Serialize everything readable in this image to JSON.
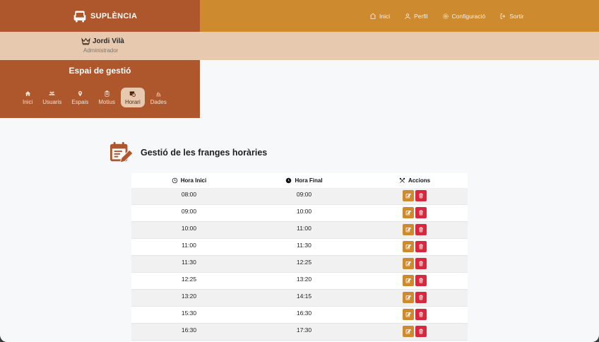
{
  "brand": {
    "name": "SUPLÈNCIA"
  },
  "nav": [
    {
      "label": "Inici",
      "icon": "home-icon"
    },
    {
      "label": "Perfil",
      "icon": "user-icon"
    },
    {
      "label": "Configuració",
      "icon": "gear-icon"
    },
    {
      "label": "Sortir",
      "icon": "logout-icon"
    }
  ],
  "user": {
    "name": "Jordi Vilà",
    "role": "Administrador"
  },
  "panel": {
    "title": "Espai de gestió",
    "tabs": [
      {
        "label": "Inici",
        "icon": "home-icon"
      },
      {
        "label": "Usuaris",
        "icon": "users-icon"
      },
      {
        "label": "Espais",
        "icon": "map-pin-icon"
      },
      {
        "label": "Motius",
        "icon": "clipboard-icon"
      },
      {
        "label": "Horari",
        "icon": "calendar-clock-icon",
        "active": true
      },
      {
        "label": "Dades",
        "icon": "chart-icon"
      }
    ]
  },
  "section": {
    "title": "Gestió de les franges horàries"
  },
  "table": {
    "headers": {
      "start": "Hora Inici",
      "end": "Hora Final",
      "actions": "Accions"
    },
    "rows": [
      {
        "start": "08:00",
        "end": "09:00"
      },
      {
        "start": "09:00",
        "end": "10:00"
      },
      {
        "start": "10:00",
        "end": "11:00"
      },
      {
        "start": "11:00",
        "end": "11:30"
      },
      {
        "start": "11:30",
        "end": "12:25"
      },
      {
        "start": "12:25",
        "end": "13:20"
      },
      {
        "start": "13:20",
        "end": "14:15"
      },
      {
        "start": "15:30",
        "end": "16:30"
      },
      {
        "start": "16:30",
        "end": "17:30"
      }
    ]
  },
  "colors": {
    "brand_dark": "#ae562c",
    "brand_gold": "#cd8a2f",
    "user_bar": "#e6c9ae",
    "edit_button": "#d08a2e",
    "delete_button": "#d9283e"
  }
}
